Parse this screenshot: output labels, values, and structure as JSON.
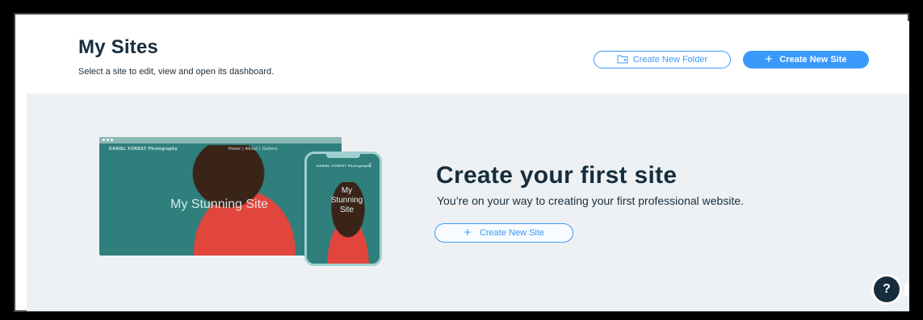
{
  "header": {
    "title": "My Sites",
    "subtitle": "Select a site to edit, view and open its dashboard.",
    "create_folder_label": "Create New Folder",
    "create_site_label": "Create New Site"
  },
  "hero": {
    "desktop_brand": "DANIEL FOREST\nPhotography",
    "desktop_nav": "Home  |  About  |  Gallery",
    "desktop_headline": "My Stunning Site",
    "phone_brand": "DANIEL FOREST\nPhotography",
    "phone_headline": "My Stunning Site"
  },
  "cta": {
    "title": "Create your first site",
    "subtitle": "You’re on your way to creating your first professional website.",
    "button_label": "Create New Site"
  },
  "help": {
    "icon_text": "?"
  },
  "colors": {
    "accent": "#3b99fc",
    "title": "#162d3d",
    "background": "#eef1f4"
  },
  "icons": {
    "folder": "folder-add-icon",
    "plus": "plus-icon",
    "help": "help-icon"
  }
}
